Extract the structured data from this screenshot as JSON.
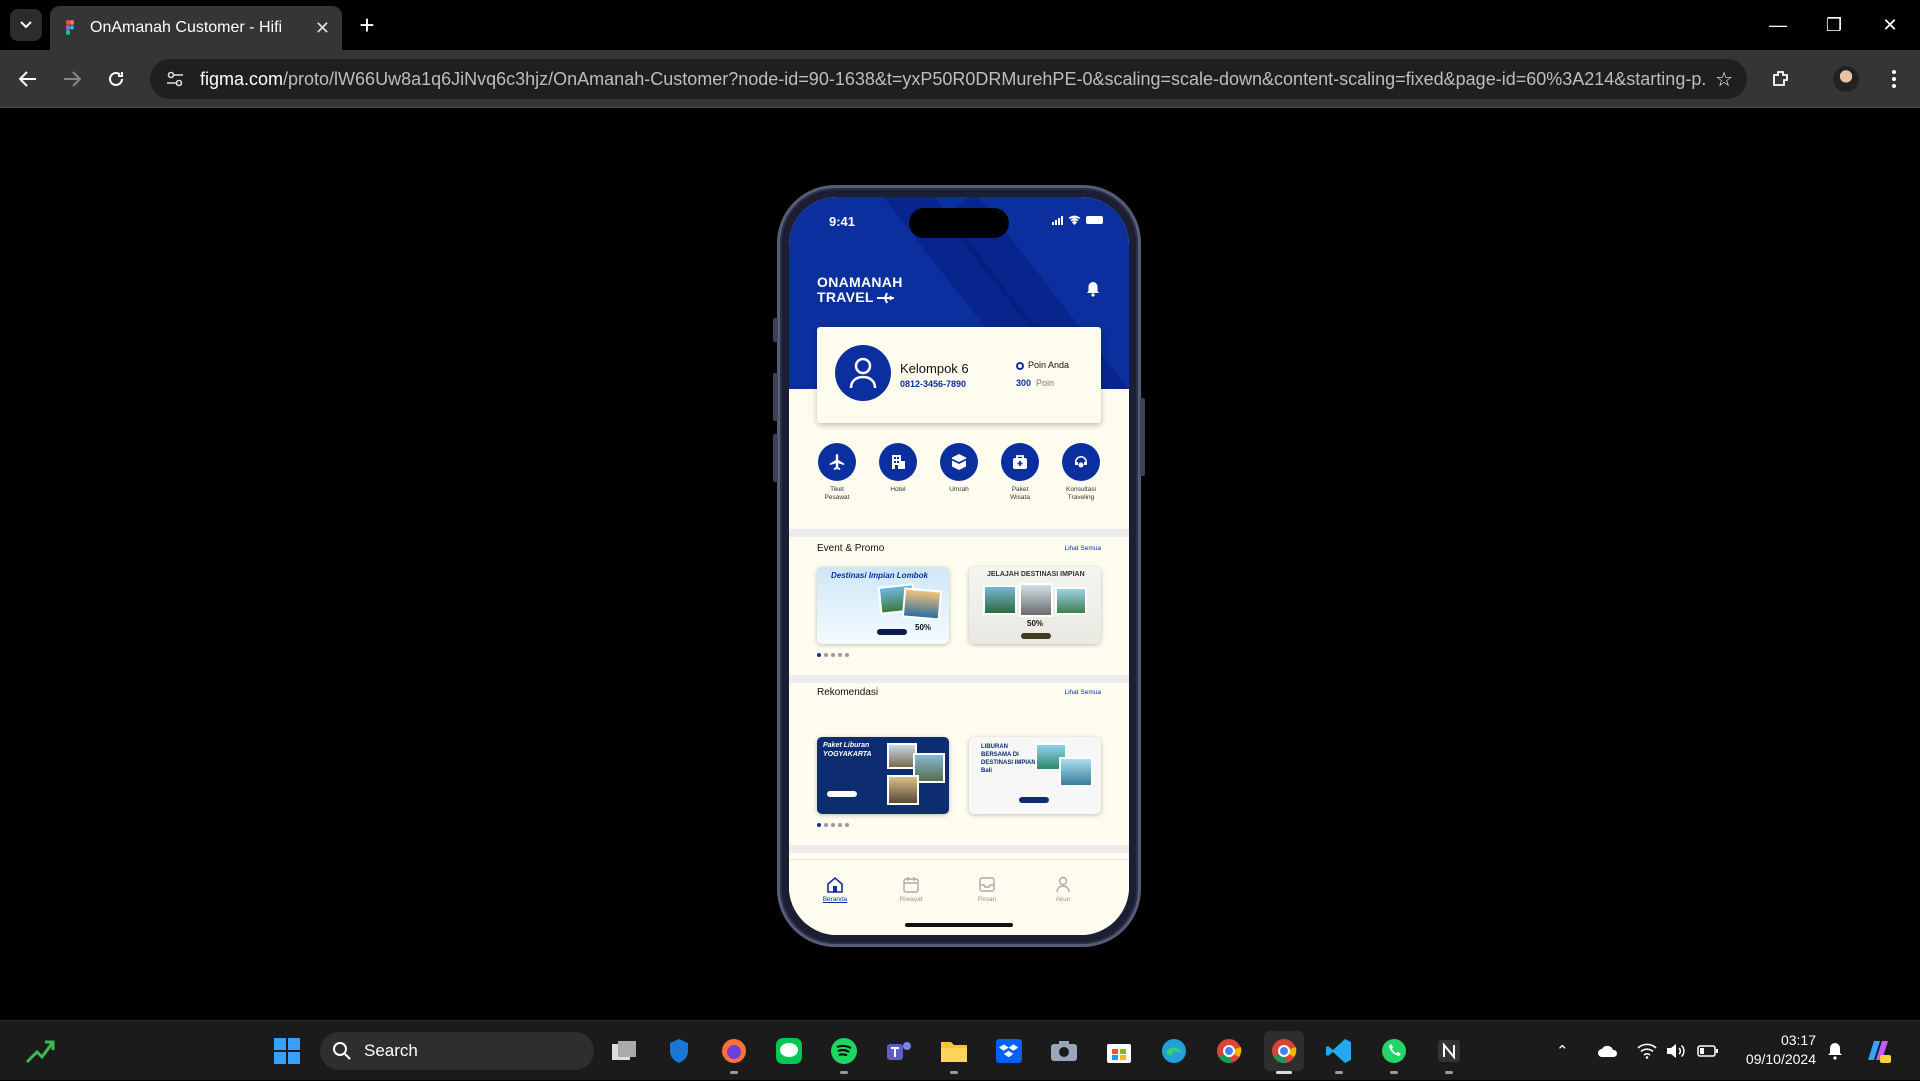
{
  "browser": {
    "tab_title": "OnAmanah Customer - Hifi",
    "url_host": "figma.com",
    "url_path": "/proto/lW66Uw8a1q6JiNvq6c3hjz/OnAmanah-Customer?node-id=90-1638&t=yxP50R0DRMurehPE-0&scaling=scale-down&content-scaling=fixed&page-id=60%3A214&starting-p...",
    "colors": {
      "chrome_bg": "#353535",
      "omnibox_bg": "#1f1f1f"
    }
  },
  "app": {
    "status_time": "9:41",
    "logo_line1": "ONAMANAH",
    "logo_line2": "TRAVEL",
    "profile": {
      "name": "Kelompok 6",
      "phone": "0812-3456-7890",
      "points_label": "Poin Anda",
      "points_value": "300",
      "points_unit": "Poin"
    },
    "services": [
      {
        "label": "Tiket\nPesawat",
        "icon": "plane-icon"
      },
      {
        "label": "Hotel",
        "icon": "hotel-icon"
      },
      {
        "label": "Umrah",
        "icon": "kaaba-icon"
      },
      {
        "label": "Paket\nWisata",
        "icon": "suitcase-icon"
      },
      {
        "label": "Konsultasi\nTraveling",
        "icon": "consult-icon"
      }
    ],
    "event_promo": {
      "title": "Event & Promo",
      "see_all": "Lihat Semua",
      "cards": [
        {
          "title": "Destinasi Impian Lombok",
          "badge": "50%"
        },
        {
          "title": "JELAJAH DESTINASI IMPIAN",
          "badge": "50%"
        }
      ]
    },
    "recommendations": {
      "title": "Rekomendasi",
      "see_all": "Lihat Semua",
      "cards": [
        {
          "title": "Paket Liburan YOGYAKARTA"
        },
        {
          "title": "LIBURAN BERSAMA DI DESTINASI IMPIAN Bali"
        }
      ]
    },
    "bottom_nav": [
      {
        "label": "Beranda",
        "icon": "home-icon",
        "active": true
      },
      {
        "label": "Riwayat",
        "icon": "history-icon",
        "active": false
      },
      {
        "label": "Pesan",
        "icon": "message-icon",
        "active": false
      },
      {
        "label": "Akun",
        "icon": "account-icon",
        "active": false
      }
    ],
    "colors": {
      "primary": "#0b2f9e",
      "background": "#fdfcee"
    }
  },
  "taskbar": {
    "search_placeholder": "Search",
    "time": "03:17",
    "date": "09/10/2024"
  }
}
